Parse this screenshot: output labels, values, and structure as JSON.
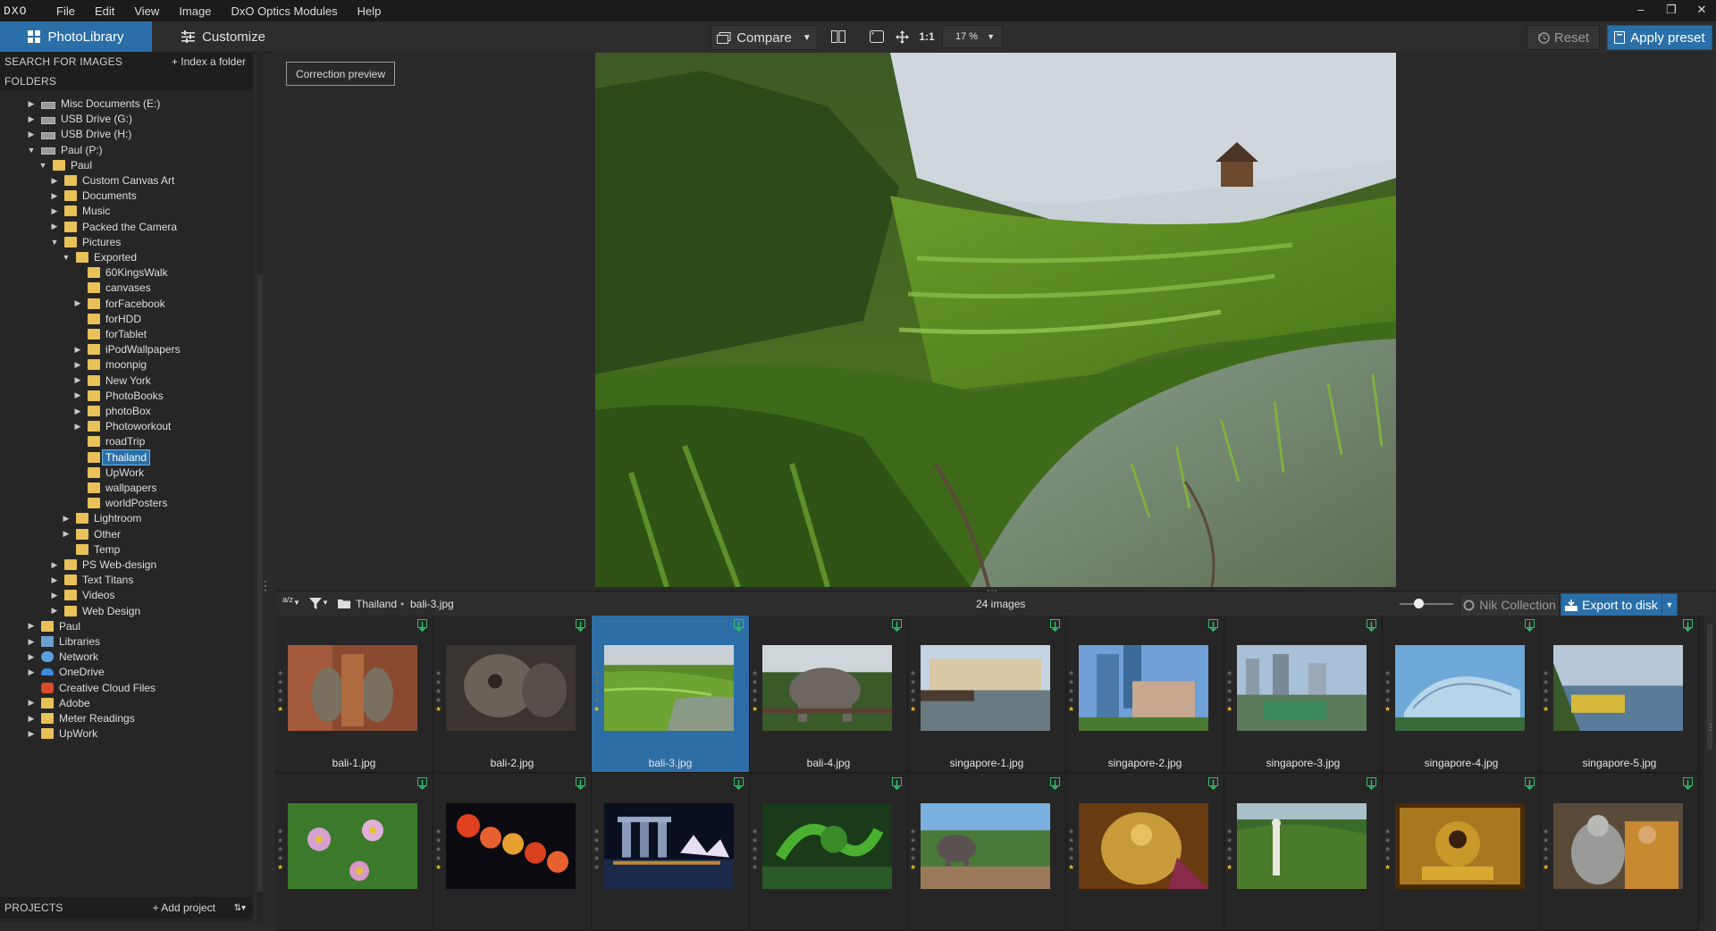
{
  "app": {
    "logo": "DXO"
  },
  "menu": [
    "File",
    "Edit",
    "View",
    "Image",
    "DxO Optics Modules",
    "Help"
  ],
  "window_controls": {
    "minimize": "–",
    "restore": "❐",
    "close": "✕"
  },
  "tabs": {
    "photolibrary": "PhotoLibrary",
    "customize": "Customize"
  },
  "toolbar": {
    "compare": "Compare",
    "one_to_one": "1:1",
    "zoom": "17 %",
    "reset": "Reset",
    "apply_preset": "Apply preset"
  },
  "left_panel": {
    "search_label": "SEARCH FOR IMAGES",
    "index_folder": "+ Index a folder",
    "folders_label": "FOLDERS",
    "projects_label": "PROJECTS",
    "add_project": "+ Add project"
  },
  "tree": [
    {
      "label": "Misc Documents (E:)",
      "icon": "drive-icon",
      "level": 0,
      "arrow": "▶"
    },
    {
      "label": "USB Drive (G:)",
      "icon": "drive-icon",
      "level": 0,
      "arrow": "▶"
    },
    {
      "label": "USB Drive (H:)",
      "icon": "drive-icon",
      "level": 0,
      "arrow": "▶"
    },
    {
      "label": "Paul (P:)",
      "icon": "drive-icon",
      "level": 0,
      "arrow": "▼"
    },
    {
      "label": "Paul",
      "icon": "folder-icon",
      "level": 1,
      "arrow": "▼"
    },
    {
      "label": "Custom Canvas Art",
      "icon": "folder-icon",
      "level": 2,
      "arrow": "▶"
    },
    {
      "label": "Documents",
      "icon": "folder-icon",
      "level": 2,
      "arrow": "▶"
    },
    {
      "label": "Music",
      "icon": "folder-icon",
      "level": 2,
      "arrow": "▶"
    },
    {
      "label": "Packed the Camera",
      "icon": "folder-icon",
      "level": 2,
      "arrow": "▶"
    },
    {
      "label": "Pictures",
      "icon": "folder-icon",
      "level": 2,
      "arrow": "▼"
    },
    {
      "label": "Exported",
      "icon": "folder-icon",
      "level": 3,
      "arrow": "▼"
    },
    {
      "label": "60KingsWalk",
      "icon": "folder-icon",
      "level": 4,
      "arrow": ""
    },
    {
      "label": "canvases",
      "icon": "folder-icon",
      "level": 4,
      "arrow": ""
    },
    {
      "label": "forFacebook",
      "icon": "folder-icon",
      "level": 4,
      "arrow": "▶"
    },
    {
      "label": "forHDD",
      "icon": "folder-icon",
      "level": 4,
      "arrow": ""
    },
    {
      "label": "forTablet",
      "icon": "folder-icon",
      "level": 4,
      "arrow": ""
    },
    {
      "label": "iPodWallpapers",
      "icon": "folder-icon",
      "level": 4,
      "arrow": "▶"
    },
    {
      "label": "moonpig",
      "icon": "folder-icon",
      "level": 4,
      "arrow": "▶"
    },
    {
      "label": "New York",
      "icon": "folder-icon",
      "level": 4,
      "arrow": "▶"
    },
    {
      "label": "PhotoBooks",
      "icon": "folder-icon",
      "level": 4,
      "arrow": "▶"
    },
    {
      "label": "photoBox",
      "icon": "folder-icon",
      "level": 4,
      "arrow": "▶"
    },
    {
      "label": "Photoworkout",
      "icon": "folder-icon",
      "level": 4,
      "arrow": "▶"
    },
    {
      "label": "roadTrip",
      "icon": "folder-icon",
      "level": 4,
      "arrow": ""
    },
    {
      "label": "Thailand",
      "icon": "folder-icon",
      "level": 4,
      "arrow": "",
      "selected": true
    },
    {
      "label": "UpWork",
      "icon": "folder-icon",
      "level": 4,
      "arrow": ""
    },
    {
      "label": "wallpapers",
      "icon": "folder-icon",
      "level": 4,
      "arrow": ""
    },
    {
      "label": "worldPosters",
      "icon": "folder-icon",
      "level": 4,
      "arrow": ""
    },
    {
      "label": "Lightroom",
      "icon": "folder-icon",
      "level": 3,
      "arrow": "▶"
    },
    {
      "label": "Other",
      "icon": "folder-icon",
      "level": 3,
      "arrow": "▶"
    },
    {
      "label": "Temp",
      "icon": "folder-icon",
      "level": 3,
      "arrow": ""
    },
    {
      "label": "PS Web-design",
      "icon": "folder-icon",
      "level": 2,
      "arrow": "▶"
    },
    {
      "label": "Text Titans",
      "icon": "folder-icon",
      "level": 2,
      "arrow": "▶"
    },
    {
      "label": "Videos",
      "icon": "folder-icon",
      "level": 2,
      "arrow": "▶"
    },
    {
      "label": "Web Design",
      "icon": "folder-icon",
      "level": 2,
      "arrow": "▶"
    },
    {
      "label": "Paul",
      "icon": "folder-icon",
      "level": 0,
      "arrow": "▶"
    },
    {
      "label": "Libraries",
      "icon": "libraries-icon",
      "level": 0,
      "arrow": "▶"
    },
    {
      "label": "Network",
      "icon": "network-icon",
      "level": 0,
      "arrow": "▶"
    },
    {
      "label": "OneDrive",
      "icon": "onedrive-icon",
      "level": 0,
      "arrow": "▶"
    },
    {
      "label": "Creative Cloud Files",
      "icon": "creative-cloud-icon",
      "level": 0,
      "arrow": ""
    },
    {
      "label": "Adobe",
      "icon": "folder-icon",
      "level": 0,
      "arrow": "▶"
    },
    {
      "label": "Meter Readings",
      "icon": "folder-icon",
      "level": 0,
      "arrow": "▶"
    },
    {
      "label": "UpWork",
      "icon": "folder-icon",
      "level": 0,
      "arrow": "▶"
    }
  ],
  "viewer": {
    "correction_preview": "Correction preview"
  },
  "filmbar": {
    "sort_icon": "a/z",
    "breadcrumb_folder": "Thailand",
    "breadcrumb_sep": "•",
    "breadcrumb_file": "bali-3.jpg",
    "count": "24 images",
    "nik": "Nik Collection",
    "export": "Export to disk"
  },
  "thumbnails_row1": [
    {
      "name": "bali-1.jpg",
      "stars": 1,
      "theme": "temple-red"
    },
    {
      "name": "bali-2.jpg",
      "stars": 1,
      "theme": "stone"
    },
    {
      "name": "bali-3.jpg",
      "stars": 1,
      "theme": "rice",
      "selected": true
    },
    {
      "name": "bali-4.jpg",
      "stars": 1,
      "theme": "elephant"
    },
    {
      "name": "singapore-1.jpg",
      "stars": 1,
      "theme": "waterfront"
    },
    {
      "name": "singapore-2.jpg",
      "stars": 1,
      "theme": "towers"
    },
    {
      "name": "singapore-3.jpg",
      "stars": 1,
      "theme": "city"
    },
    {
      "name": "singapore-4.jpg",
      "stars": 1,
      "theme": "dome"
    },
    {
      "name": "singapore-5.jpg",
      "stars": 1,
      "theme": "bay"
    }
  ],
  "thumbnails_row2": [
    {
      "theme": "flowers",
      "stars": 1
    },
    {
      "theme": "lanterns",
      "stars": 1
    },
    {
      "theme": "night",
      "stars": 0
    },
    {
      "theme": "snake",
      "stars": 0
    },
    {
      "theme": "elephant2",
      "stars": 1
    },
    {
      "theme": "gold",
      "stars": 1
    },
    {
      "theme": "jungle",
      "stars": 1
    },
    {
      "theme": "gold2",
      "stars": 1
    },
    {
      "theme": "monk",
      "stars": 1
    }
  ],
  "colors": {
    "accent": "#2a6fa8",
    "folder": "#e9c159",
    "flag": "#2fbf68",
    "star": "#f0c020"
  }
}
